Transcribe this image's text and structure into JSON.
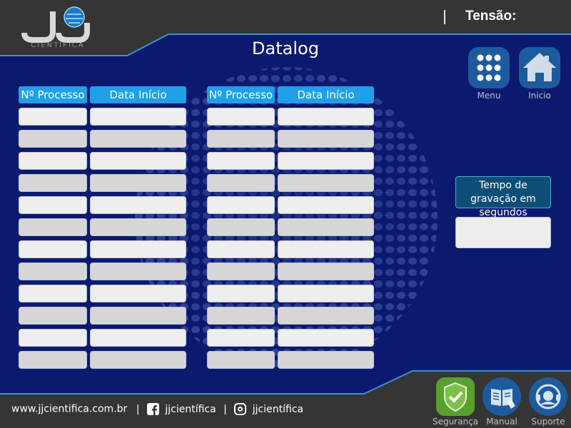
{
  "header": {
    "logo_text": "CIENTÍFICA",
    "tensao_label": "Tensão:",
    "title": "Datalog"
  },
  "table": {
    "columns": [
      "Nº Processo",
      "Data Início",
      "Nº Processo",
      "Data Início"
    ]
  },
  "nav": {
    "menu_label": "Menu",
    "home_label": "Inicio"
  },
  "tempo": {
    "label": "Tempo de gravação em segundos",
    "value": ""
  },
  "footer": {
    "website": "www.jjcientifica.com.br",
    "sep1": "|",
    "facebook": "jjcientífica",
    "sep2": "|",
    "instagram": "jjcientífica",
    "seguranca_label": "Segurança",
    "manual_label": "Manual",
    "suporte_label": "Suporte"
  },
  "colors": {
    "background": "#0b1a6e",
    "band": "#353535",
    "header_cell": "#1fa0e8",
    "seguranca": "#5aa02c",
    "nav_button": "#1d5b9f"
  },
  "icons": [
    "menu-grid-icon",
    "home-icon",
    "shield-check-icon",
    "manual-book-icon",
    "support-headset-icon",
    "facebook-icon",
    "instagram-icon"
  ]
}
